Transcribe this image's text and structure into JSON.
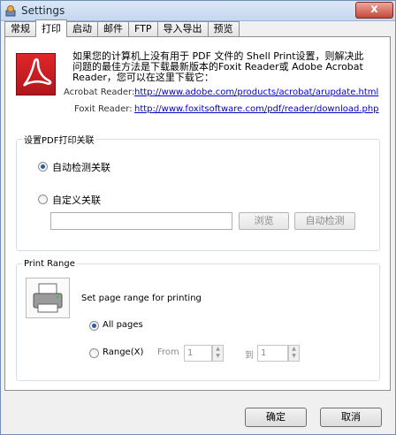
{
  "window": {
    "title": "Settings",
    "close_glyph": "x"
  },
  "tabs": [
    "常规",
    "打印",
    "启动",
    "邮件",
    "FTP",
    "导入导出",
    "预览"
  ],
  "active_tab": "打印",
  "info": {
    "text": "如果您的计算机上没有用于 PDF 文件的 Shell Print设置，则解决此问题的最佳方法是下载最新版本的Foxit Reader或 Adobe Acrobat Reader，您可以在这里下载它：",
    "acrobat_label": "Acrobat Reader:",
    "acrobat_url": "http://www.adobe.com/products/acrobat/arupdate.html",
    "foxit_label": "Foxit Reader:",
    "foxit_url": "http://www.foxitsoftware.com/pdf/reader/download.php"
  },
  "assoc": {
    "legend": "设置PDF打印关联",
    "auto_label": "自动检测关联",
    "custom_label": "自定义关联",
    "path_value": "",
    "browse_label": "浏览",
    "autodetect_label": "自动检测",
    "selected": "auto"
  },
  "range": {
    "legend": "Print Range",
    "description": "Set page range for printing",
    "all_label": "All pages",
    "range_label": "Range(X)",
    "from_label": "From",
    "from_value": "1",
    "to_label": "到",
    "to_value": "1",
    "selected": "all"
  },
  "buttons": {
    "ok": "确定",
    "cancel": "取消"
  },
  "colors": {
    "accent": "#2a5aa8",
    "link": "#0000cc",
    "pdf_red": "#d0191e"
  },
  "icons": {
    "app": "settings-app-icon",
    "pdf": "adobe-pdf-icon",
    "printer": "printer-icon"
  }
}
